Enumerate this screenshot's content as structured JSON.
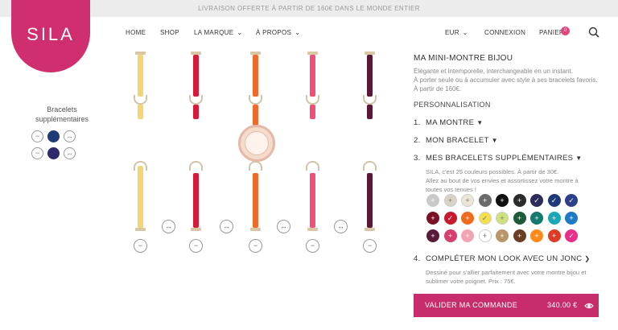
{
  "promo": "LIVRAISON OFFERTE À PARTIR DE 160€ DANS LE MONDE ENTIER",
  "logo": "SILA",
  "nav": {
    "home": "HOME",
    "shop": "SHOP",
    "marque": "LA MARQUE",
    "apropos": "À PROPOS",
    "currency": "EUR",
    "connexion": "CONNEXION",
    "panier": "PANIER",
    "cart_count": "0"
  },
  "options": {
    "title_line1": "Bracelets",
    "title_line2": "supplémentaires"
  },
  "product": {
    "title": "MA MINI-MONTRE BIJOU",
    "desc1": "Élégante et intemporelle, interchangeable en un instant.",
    "desc2": "À porter seule ou à accumuler avec style à ses bracelets favoris.",
    "desc3": "À partir de 160€.",
    "perso": "PERSONNALISATION",
    "step1_num": "1.",
    "step1": "MA MONTRE",
    "step2_num": "2.",
    "step2": "MON BRACELET",
    "step3_num": "3.",
    "step3": "MES BRACELETS SUPPLÉMENTAIRES",
    "step3_text1": "SILA, c'est 25 couleurs possibles. À partir de 30€.",
    "step3_text2": "Allez au bout de vos envies et assortissez votre montre à",
    "step3_text3": "toutes vos tenues !",
    "step4_num": "4.",
    "step4": "COMPLÉTER MON LOOK AVEC UN JONC",
    "step4_text1": "Dessiné pour s'allier parfaitement avec votre montre bijou et",
    "step4_text2": "sublimer votre poignet. Prix : 75€."
  },
  "cta": {
    "label": "VALIDER MA COMMANDE",
    "price": "340.00 €"
  },
  "colors": {
    "brand": "#cf2f6e",
    "cta": "#c82d6b",
    "swatches": [
      "#c9c9c9",
      "#d9d2c6",
      "#ece6d6",
      "#6b6b6b",
      "#111111",
      "#2b2b2b",
      "#2d2a5c",
      "#1f3a7a",
      "#2b3f8a",
      "#7a1026",
      "#c81a2e",
      "#ef6a1b",
      "#f5e04a",
      "#cfe27a",
      "#1e5a3a",
      "#127a6e",
      "#19a8b5",
      "#1f7ac4",
      "#5a1a3a",
      "#d6406e",
      "#f3a4b4",
      "#ffffff",
      "#b8956a",
      "#6a3e22",
      "#ff8a1a",
      "#e03a24",
      "#ea2d8a"
    ]
  }
}
